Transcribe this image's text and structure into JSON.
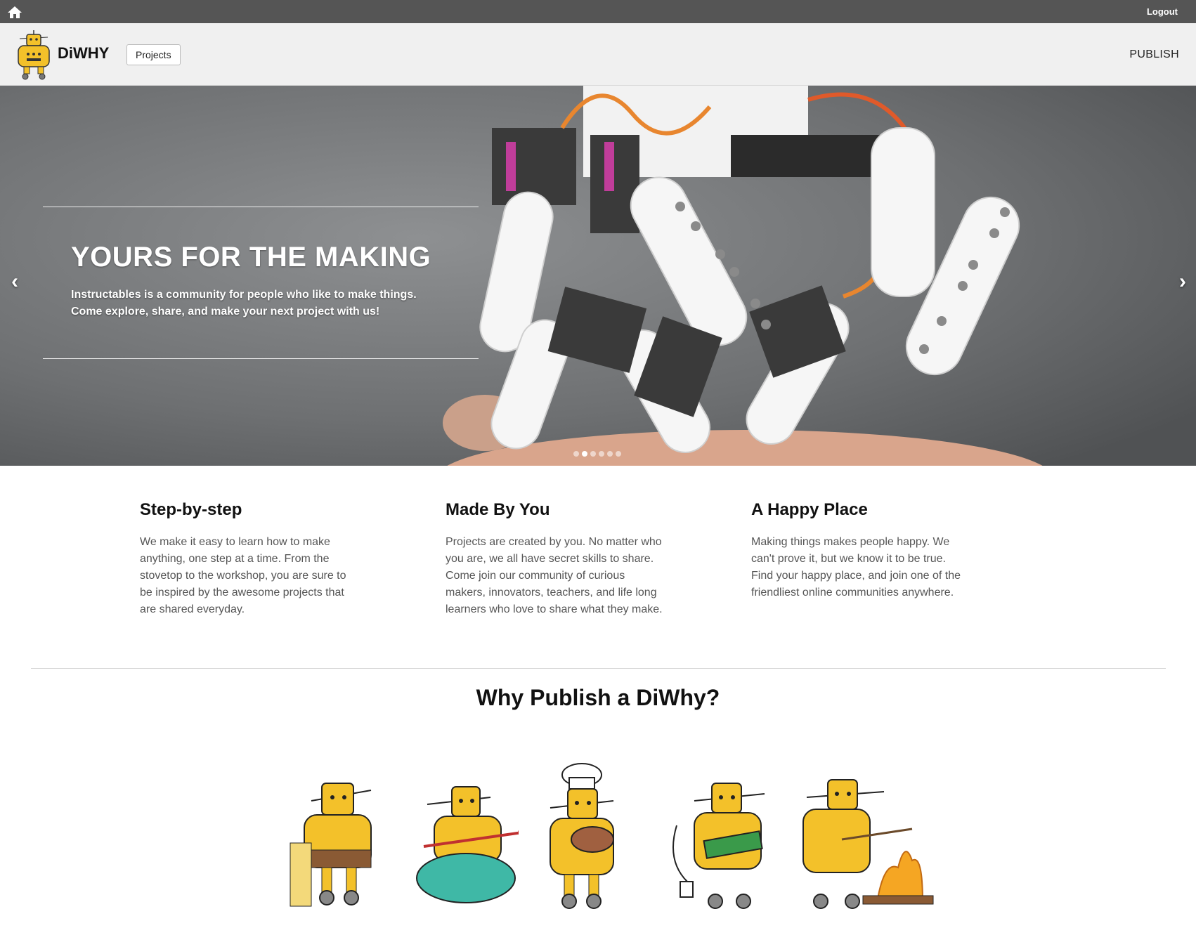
{
  "topbar": {
    "home_icon": "home-icon",
    "logout_label": "Logout"
  },
  "header": {
    "brand": "DiWHY",
    "projects_label": "Projects",
    "publish_label": "PUBLISH"
  },
  "hero": {
    "title": "YOURS FOR THE MAKING",
    "subtitle_line1": "Instructables is a community for people who like to make things.",
    "subtitle_line2": "Come explore, share, and make your next project with us!",
    "prev_icon": "‹",
    "next_icon": "›",
    "slide_count": 6,
    "active_slide": 1
  },
  "features": [
    {
      "title": "Step-by-step",
      "text": "We make it easy to learn how to make anything, one step at a time. From the stovetop to the workshop, you are sure to be inspired by the awesome projects that are shared everyday."
    },
    {
      "title": "Made By You",
      "text": "Projects are created by you. No matter who you are, we all have secret skills to share. Come join our community of curious makers, innovators, teachers, and life long learners who love to share what they make."
    },
    {
      "title": "A Happy Place",
      "text": "Making things makes people happy. We can't prove it, but we know it to be true. Find your happy place, and join one of the friendliest online communities anywhere."
    }
  ],
  "why_title": "Why Publish a DiWhy?",
  "colors": {
    "topbar": "#555555",
    "header": "#f0f0f0",
    "robot_yellow": "#f3c12a"
  }
}
